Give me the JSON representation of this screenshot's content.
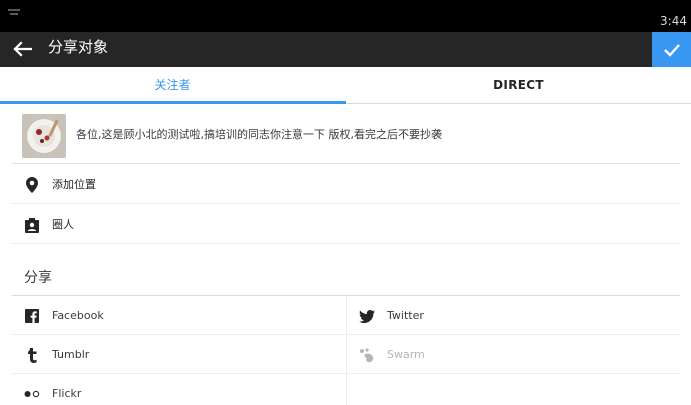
{
  "status_bar": {
    "time": "3:44",
    "notification_icon": "notification-icon"
  },
  "action_bar": {
    "title": "分享对象",
    "back_icon": "arrow-left-icon",
    "confirm_icon": "checkmark-icon",
    "accent": "#3897f0"
  },
  "tabs": [
    {
      "label": "关注者",
      "selected": true
    },
    {
      "label": "DIRECT",
      "selected": false
    }
  ],
  "post": {
    "caption": "各位,这是顾小北的测试啦,搞培训的同志你注意一下 版权,看完之后不要抄袭"
  },
  "options": [
    {
      "label": "添加位置",
      "icon": "location-pin-icon"
    },
    {
      "label": "圈人",
      "icon": "tag-people-icon"
    }
  ],
  "share": {
    "header": "分享",
    "targets": [
      {
        "label": "Facebook",
        "icon": "facebook-icon",
        "enabled": true
      },
      {
        "label": "Twitter",
        "icon": "twitter-icon",
        "enabled": true
      },
      {
        "label": "Tumblr",
        "icon": "tumblr-icon",
        "enabled": true
      },
      {
        "label": "Swarm",
        "icon": "swarm-icon",
        "enabled": false
      },
      {
        "label": "Flickr",
        "icon": "flickr-icon",
        "enabled": true
      }
    ]
  }
}
